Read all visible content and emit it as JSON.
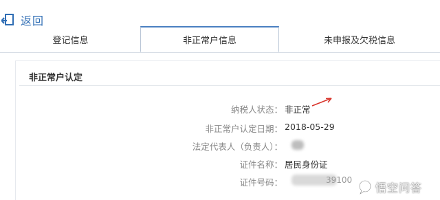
{
  "header": {
    "back_label": "返回"
  },
  "tabs": [
    {
      "label": "登记信息",
      "active": false
    },
    {
      "label": "非正常户信息",
      "active": true
    },
    {
      "label": "未申报及欠税信息",
      "active": false
    }
  ],
  "section": {
    "title": "非正常户认定"
  },
  "fields": [
    {
      "label": "纳税人状态：",
      "value": "非正常"
    },
    {
      "label": "非正常户认定日期：",
      "value": "2018-05-29"
    },
    {
      "label": "法定代表人（负责人）：",
      "value": ""
    },
    {
      "label": "证件名称：",
      "value": "居民身份证"
    },
    {
      "label": "证件号码：",
      "value": ""
    }
  ],
  "id_number_visible_fragment": "39100",
  "watermark": {
    "text": "悟空问答"
  },
  "colors": {
    "accent": "#2f6db4",
    "arrow": "#d9342b"
  }
}
